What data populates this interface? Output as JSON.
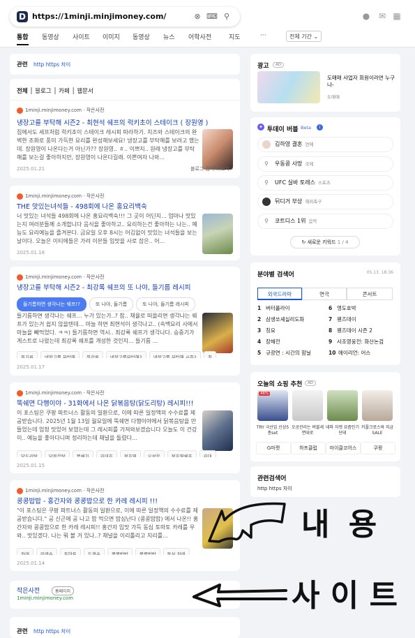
{
  "search": {
    "url": "https://1minji.minjimoney.com/",
    "logo": "D",
    "period": "전체 기간"
  },
  "tabs": [
    "통합",
    "동영상",
    "사이트",
    "이미지",
    "동영상",
    "뉴스",
    "어학사전",
    "지도",
    "···"
  ],
  "related_top": {
    "label": "관련",
    "query": "http https 차이"
  },
  "filter_tabs": [
    "전체",
    "블로그",
    "카페",
    "웹문서"
  ],
  "results": [
    {
      "site": "1minji.minjimoney.com · 작은사전",
      "title": "냉장고를 부탁해 시즌2 - 최현석 쉐프의 럭키초이 스테이크 ( 장원영 )",
      "snippet": "집에서도 세프처럼 럭키초이 스테이크 레시피 따라하기. 치즈와 스테이크의 완벽한 조화로 풍미 가득한 요리를 완성해보세요! 냉장고를 부탁해를 보려고 했는데. 장원영이 나온다는거 아닌가?? 장원영.. ㅎ.. 이쁘지.. 원래 냉장고를 부탁해를 보는걸 좋아하지만, 장원영이 나온다길래. 이쁜여자 나와...",
      "date": "2025.01.21",
      "extra": "블로그 검색 더보기 ›"
    },
    {
      "site": "1minji.minjimoney.com · 작은사전",
      "title": "THE 맛있는녀석들 - 498회에 나온 홍요리백숙",
      "snippet": "너 맛있는 녀석들 498회에 나온 홍요리백숙!!! 그 곳이 어딘지... 엄마나 맛있는지 여러분들께 소개합니다 음식을 좋아하고.. 요리하는건 좋아하는 나는.. 예능도 요리예능을 즐겨본다. 금요일 오후 8시는 어김없이 맛있는 녀석들을 보는 날이다. 오늘은 이티에들은 가려 이븐들 입맛을 사로 잡은.. 어...",
      "date": "2025.01.18"
    },
    {
      "site": "1minji.minjimoney.com · 작은사전",
      "title": "냉장고를 부탁해 시즌2 - 최강록 쉐프의 또 나야, 들기름 레시피",
      "pills": [
        "들기름하면 생각나는 쉐프!?",
        "또 나야, 들기름",
        "또 나야, 들기름 레시피"
      ],
      "snippet": "들기름하면 생각나는 쉐프... 누가 있는가..? 참.. 채율로 떠올리면 생각나는 쉐프가 있는거 쉽지 않을텐데... 마늘 하면 최현석이 생각나고.. (속백요리 사에서 마늘을 빼먹었다. ㅋㅋ) 들기름하면 역시.. 최강록 쉐프가 생각나다. 승중기가 게스트로 나왔는데 최강록 쉐프를 개성한 것인지... 들기름 ...",
      "chips": [
        "들기름",
        "냉장고를 부탁해",
        "최강록",
        "냉장고를부탁해2",
        "냉장고를 부탁해 시즌2",
        "최"
      ],
      "date": "2025.01.17"
    },
    {
      "site": "1minji.minjimoney.com · 작은사전",
      "title": "뚝쉐면 다행이야 - 31화에서 나온 닭볶음탕(닭도리탕) 레시피!!!",
      "snippet": "이 포스팅은 쿠팡 파트너스 활동의 일환으로, 이에 따른 일정액의 수수료를 제공받습니다. 2025년 1월 13일 월요일에 뚝쉐면 다행이야에서 닭볶음탕을 만들었는데 엄청 맛있어 보였는데 그 레시피를 가져와보겠습니다 오늘도 이 건강이.. 예능을 좋아다니며 정리하는데 채널을 돌렸다...",
      "chips": [
        "닭도리탕",
        "닭볶음탕",
        "뚝쉐기",
        "김대호",
        "정호영",
        "오성욱",
        "정호영쉐프",
        "김대"
      ],
      "date": "2025.01.15"
    },
    {
      "site": "1minji.minjimoney.com · 작은사전",
      "title": "콩콩밥밥 - 홍간자와 콩콩밥으로 한 카레 레시피 !!!",
      "snippet": "\"이 포스팅은 쿠팡 파트너스 활동의 일환으로, 이에 따른 일정액의 수수료를 제공받습니다.\" 공 신곤에 공 나고 밥 먹으면 밥심난다 (콩콩밥밥) 에서 나온!! 홍간자와 콩콩밥으로 한 카레 레시피!! 홍간자 입맛 가득 동심 토마토 카레를 우와.. 맛있겠다. 나는 뭐 볼 거 있나..? 채널을 이리톨리고 지리를...",
      "chips": [
        "카레",
        "이광수",
        "토마토",
        "도경수",
        "콩콩밥밥",
        "콩콩밥밥",
        "동심 카레"
      ],
      "date": "2025.01.14"
    }
  ],
  "site_card": {
    "name": "작은사전",
    "badge": "홈페이지",
    "domain": "1minji.minjimoney.com"
  },
  "bottom_related": {
    "label": "관련",
    "query": "http https 차이"
  },
  "ad": {
    "label": "광고",
    "badge": "AD",
    "text": "도매매 사업자 회원이라면 누구나-",
    "sub": "도매매"
  },
  "today": {
    "title": "투데이 버블",
    "badge": "Beta",
    "items": [
      {
        "name": "김하영 결혼",
        "cat": "연예"
      },
      {
        "name": "우동콩 사망",
        "cat": "국제"
      },
      {
        "name": "UFC 실바 토레스",
        "cat": "스포츠"
      },
      {
        "name": "뒤디거 부상",
        "cat": "해외축구"
      },
      {
        "name": "코트디스 1위",
        "cat": "음악"
      }
    ],
    "refresh": "새로운 키워드",
    "page": "1 / 4"
  },
  "field": {
    "title": "분야별 검색어",
    "time": "05.13. 18:36",
    "tabs": [
      "외국드라마",
      "연극",
      "콘서트"
    ],
    "left": [
      [
        "1",
        "버터플라이"
      ],
      [
        "2",
        "삼생쏘셰실리도화"
      ],
      [
        "3",
        "칭요"
      ],
      [
        "4",
        "장해전"
      ],
      [
        "5",
        "규광연 : 시간의 함닐"
      ]
    ],
    "right": [
      [
        "6",
        "엥도호박"
      ],
      [
        "7",
        "웬즈데이"
      ],
      [
        "8",
        "웬즈데이 시즌 2"
      ],
      [
        "9",
        "사조영웅전: 화산논검"
      ],
      [
        "10",
        "에이리언: 어스"
      ]
    ]
  },
  "shopping": {
    "title": "오늘의 쇼핑 추천",
    "badge": "AD",
    "items": [
      "TRY 극산임 신상5종set",
      "오공관리는 버블세면대로",
      "네파 자켓 요즘인기단테",
      "키플크로스바 지금SALE"
    ],
    "sale": "46%",
    "buttons": [
      "G마켓",
      "하프클럽",
      "마이클코어스",
      "쿠팡"
    ]
  },
  "related": {
    "title": "관련검색어",
    "query": "http https 차이"
  },
  "annotation": {
    "line1": "내 용",
    "line2": "사 이 트"
  }
}
